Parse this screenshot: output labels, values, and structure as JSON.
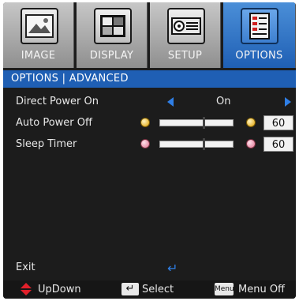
{
  "tabs": [
    {
      "label": "IMAGE",
      "icon": "image-icon",
      "active": false
    },
    {
      "label": "DISPLAY",
      "icon": "display-icon",
      "active": false
    },
    {
      "label": "SETUP",
      "icon": "projector-icon",
      "active": false
    },
    {
      "label": "OPTIONS",
      "icon": "options-icon",
      "active": true
    }
  ],
  "section_title": "OPTIONS | ADVANCED",
  "rows": {
    "direct_power_on": {
      "label": "Direct Power On",
      "value": "On"
    },
    "auto_power_off": {
      "label": "Auto Power Off",
      "value": "60",
      "level": 0.6
    },
    "sleep_timer": {
      "label": "Sleep Timer",
      "value": "60",
      "level": 0.6
    }
  },
  "exit": {
    "label": "Exit"
  },
  "help": {
    "updown": "UpDown",
    "select": "Select",
    "menu_key": "Menu",
    "menu_off": "Menu Off"
  },
  "colors": {
    "accent": "#1f5fb4",
    "arrow": "#2f7fe6",
    "updown": "#e0202a"
  }
}
